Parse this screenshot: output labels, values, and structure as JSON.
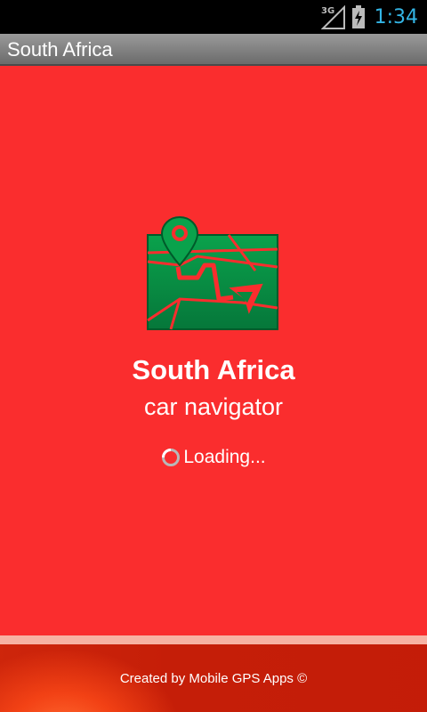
{
  "status_bar": {
    "network": "3G",
    "time": "1:34",
    "clock_color": "#33b5e5"
  },
  "title_bar": {
    "title": "South Africa"
  },
  "splash": {
    "background_color": "#fa2d2e",
    "logo_icon": "map-navigation-icon",
    "app_title": "South Africa",
    "app_subtitle": "car navigator",
    "loading_text": "Loading..."
  },
  "footer": {
    "credit": "Created by Mobile GPS Apps ©"
  }
}
